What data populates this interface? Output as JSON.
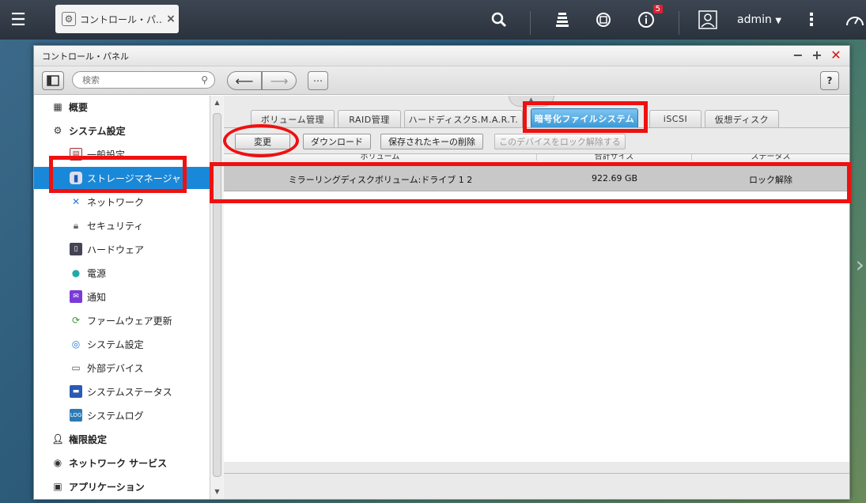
{
  "topbar": {
    "app_tab_label": "コントロール・パ...",
    "notification_count": "5",
    "user": "admin"
  },
  "window": {
    "title": "コントロール・パネル",
    "search_placeholder": "検索",
    "help_label": "?"
  },
  "sidebar": {
    "items": [
      {
        "label": "概要",
        "icon": "overview-icon",
        "level": "top"
      },
      {
        "label": "システム設定",
        "icon": "gear-icon",
        "level": "top"
      },
      {
        "label": "一般設定",
        "icon": "general-settings-icon",
        "level": "sub"
      },
      {
        "label": "ストレージマネージャ",
        "icon": "storage-icon",
        "level": "sub",
        "selected": true
      },
      {
        "label": "ネットワーク",
        "icon": "network-icon",
        "level": "sub"
      },
      {
        "label": "セキュリティ",
        "icon": "lock-icon",
        "level": "sub"
      },
      {
        "label": "ハードウェア",
        "icon": "hardware-icon",
        "level": "sub"
      },
      {
        "label": "電源",
        "icon": "power-icon",
        "level": "sub"
      },
      {
        "label": "通知",
        "icon": "notification-icon",
        "level": "sub"
      },
      {
        "label": "ファームウェア更新",
        "icon": "firmware-icon",
        "level": "sub"
      },
      {
        "label": "システム設定",
        "icon": "system-backup-icon",
        "level": "sub"
      },
      {
        "label": "外部デバイス",
        "icon": "external-device-icon",
        "level": "sub"
      },
      {
        "label": "システムステータス",
        "icon": "system-status-icon",
        "level": "sub"
      },
      {
        "label": "システムログ",
        "icon": "system-log-icon",
        "level": "sub"
      },
      {
        "label": "権限設定",
        "icon": "user-icon",
        "level": "top"
      },
      {
        "label": "ネットワーク サービス",
        "icon": "globe-icon",
        "level": "top"
      },
      {
        "label": "アプリケーション",
        "icon": "application-icon",
        "level": "top"
      }
    ]
  },
  "tabs": [
    {
      "label": "ボリューム管理"
    },
    {
      "label": "RAID管理"
    },
    {
      "label": "ハードディスクS.M.A.R.T."
    },
    {
      "label": "暗号化ファイルシステム",
      "active": true
    },
    {
      "label": "iSCSI"
    },
    {
      "label": "仮想ディスク"
    }
  ],
  "actions": {
    "change": "変更",
    "download": "ダウンロード",
    "delete_saved_key": "保存されたキーの削除",
    "unlock_device": "このデバイスをロック解除する"
  },
  "grid": {
    "columns": [
      "ボリューム",
      "合計サイズ",
      "ステータス"
    ],
    "rows": [
      {
        "volume": "ミラーリングディスクボリューム:ドライブ 1 2",
        "size": "922.69 GB",
        "status": "ロック解除"
      }
    ]
  },
  "colors": {
    "accent": "#1a88d8",
    "annotation": "#e11111"
  }
}
